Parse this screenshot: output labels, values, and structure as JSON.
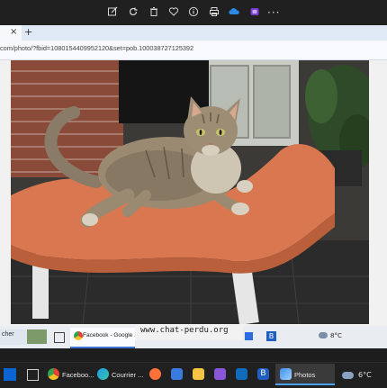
{
  "photos_toolbar": {
    "icons": [
      "edit-icon",
      "rotate-icon",
      "delete-icon",
      "heart-icon",
      "info-icon",
      "print-icon",
      "onedrive-icon",
      "clipchamp-icon",
      "more-icon"
    ],
    "more_label": "···"
  },
  "browser": {
    "tab_close": "×",
    "new_tab": "+",
    "url": "com/photo/?fbid=1080154409952120&set=pob.100038727125392"
  },
  "photo": {
    "subject": "cat-on-orange-lounge-chair"
  },
  "inner_taskbar": {
    "search_label": "cher",
    "chrome_item_label": "Facebook - Google ...",
    "weather": "8°C",
    "watermark": "www.chat-perdu.org"
  },
  "taskbar": {
    "items": [
      {
        "label": "Faceboo...",
        "icon": "chrome-icon"
      },
      {
        "label": "Courrier ...",
        "icon": "edge-icon"
      },
      {
        "label": "Photos",
        "icon": "photos-icon"
      }
    ],
    "weather_text": "6°C"
  },
  "colors": {
    "chrome_dark": "#202020",
    "tab_strip": "#dfe8f5",
    "accent": "#4aa3f0"
  }
}
